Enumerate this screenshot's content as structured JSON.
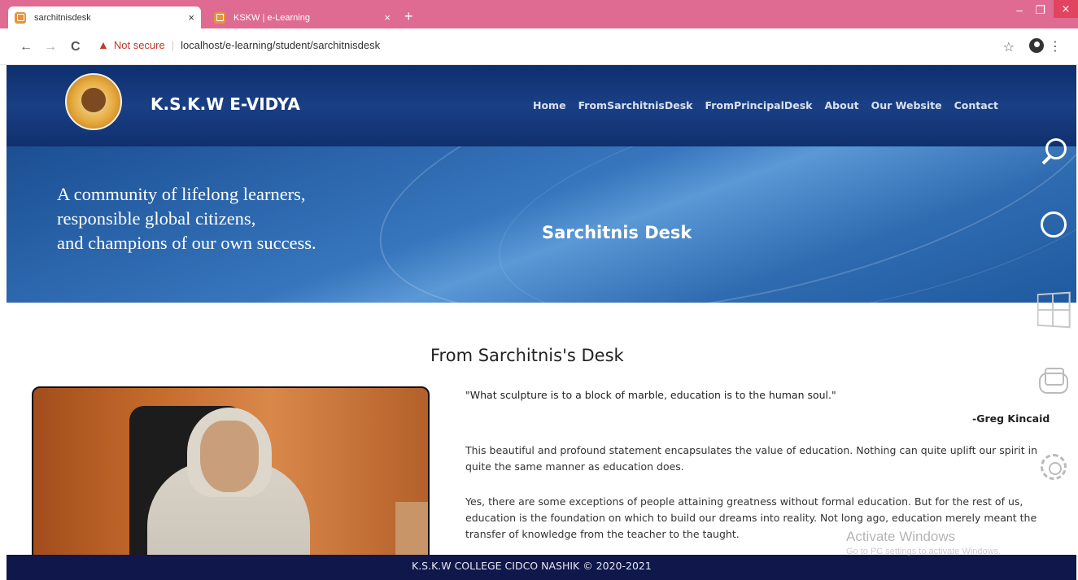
{
  "browser": {
    "tabs": [
      {
        "title": "sarchitnisdesk",
        "close": "×"
      },
      {
        "title": "KSKW | e-Learning",
        "close": "×"
      }
    ],
    "new_tab": "+",
    "window_controls": {
      "minimize": "–",
      "maximize": "❐",
      "close": "×"
    },
    "nav": {
      "back": "←",
      "forward": "→",
      "reload": "C"
    },
    "security_warning": "Not secure",
    "url": "localhost/e-learning/student/sarchitnisdesk",
    "bookmark": "☆",
    "menu": "⋮"
  },
  "site": {
    "brand": "K.S.K.W E-VIDYA",
    "nav": [
      "Home",
      "FromSarchitnisDesk",
      "FromPrincipalDesk",
      "About",
      "Our Website",
      "Contact"
    ],
    "hero": {
      "tagline": [
        "A community of lifelong learners,",
        "responsible global citizens,",
        "and champions of our own success."
      ],
      "title": "Sarchitnis Desk"
    },
    "content": {
      "heading": "From Sarchitnis's Desk",
      "quote": "\"What sculpture is to a block of marble, education is to the human soul.\"",
      "author": "-Greg Kincaid",
      "paragraphs": [
        "This beautiful and profound statement encapsulates the value of education. Nothing can quite uplift our spirit in quite the same manner as education does.",
        "Yes, there are some exceptions of people attaining greatness without formal education. But for the rest of us, education is the foundation on which to build our dreams into reality. Not long ago, education merely meant the transfer of knowledge from the teacher to the taught."
      ]
    },
    "footer": "K.S.K.W COLLEGE CIDCO NASHIK © 2020-2021"
  },
  "overlay": {
    "watermark_title": "Activate Windows",
    "watermark_sub": "Go to PC settings to activate Windows.",
    "icons": [
      "search-icon",
      "share-icon",
      "windows-start-icon",
      "devices-icon",
      "gear-icon"
    ]
  }
}
